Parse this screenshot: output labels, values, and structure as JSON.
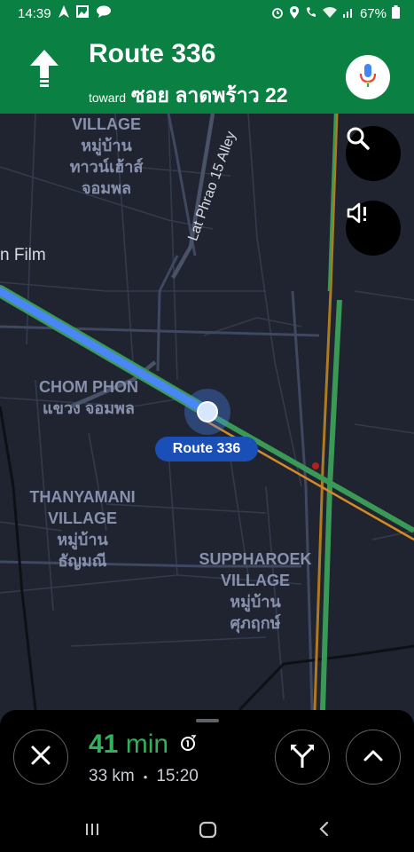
{
  "status": {
    "time": "14:39",
    "battery": "67%"
  },
  "navigation": {
    "title": "Route 336",
    "toward": "toward",
    "street": "ซอย ลาดพร้าว 22"
  },
  "map": {
    "labels": {
      "village_top": [
        "VILLAGE",
        "หมู่บ้าน",
        "ทาวน์เฮ้าส์",
        "จอมพล"
      ],
      "film": "n Film",
      "alley": "Lat Phrao 15 Alley",
      "chom_phon": [
        "CHOM PHON",
        "แขวง จอมพล"
      ],
      "thanyamani": [
        "THANYAMANI",
        "VILLAGE",
        "หมู่บ้าน",
        "ธัญมณี"
      ],
      "suppharoek": [
        "SUPPHAROEK",
        "VILLAGE",
        "หมู่บ้าน",
        "ศุภฤกษ์"
      ]
    },
    "route_chip": "Route 336"
  },
  "trip": {
    "duration_value": "41",
    "duration_unit": "min",
    "distance": "33 km",
    "separator": "•",
    "arrival": "15:20"
  },
  "colors": {
    "header_green": "#0b8043",
    "map_bg": "#1f2430",
    "route_blue": "#4b86f5",
    "eta_green": "#2fb25b"
  },
  "icons": [
    "navigation-icon",
    "image-icon",
    "messenger-icon",
    "alarm-icon",
    "location-icon",
    "wifi-calling-icon",
    "wifi-icon",
    "signal-icon",
    "battery-icon",
    "straight-arrow-icon",
    "microphone-icon",
    "search-icon",
    "sound-alert-icon",
    "close-icon",
    "fork-route-icon",
    "chevron-up-icon",
    "recent-apps-icon",
    "home-icon",
    "back-icon"
  ]
}
